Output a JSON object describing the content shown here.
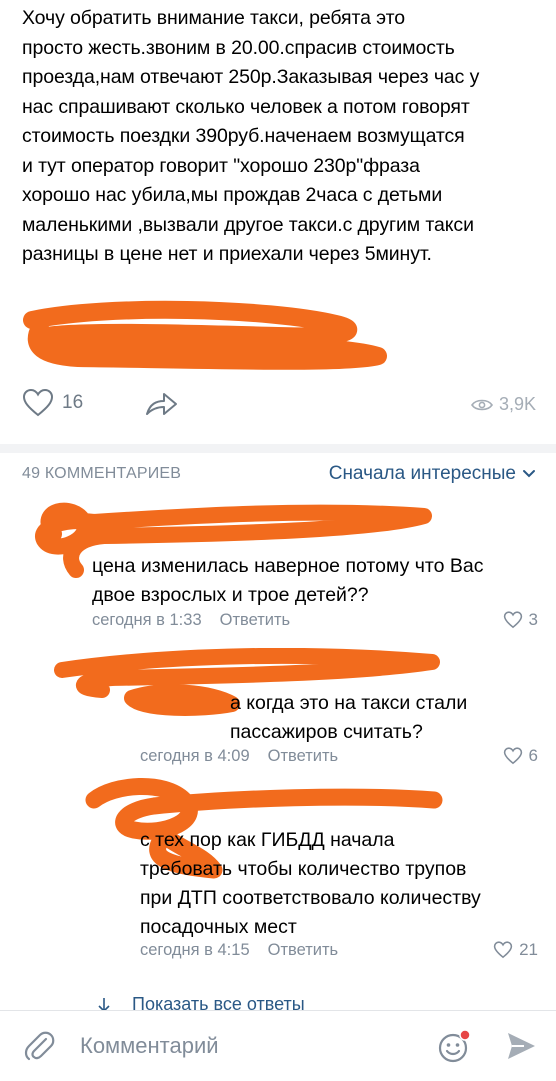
{
  "post": {
    "text": "Хочу обратить внимание такси, ребята это\nпросто жесть.звоним в 20.00.спрасив стоимость\nпроезда,нам отвечают 250р.Заказывая через час у\nнас спрашивают сколько человек а потом говорят\nстоимость поездки 390руб.наченаем возмущатся\nи тут оператор говорит \"хорошо 230р\"фраза\nхорошо нас убила,мы прождав 2часа с детьми\nмаленькими ,вызвали другое такси.с другим такси\nразницы в цене нет и приехали через 5минут.",
    "likes": "16",
    "views": "3,9K"
  },
  "comments_header": {
    "count_label": "49 КОММЕНТАРИЕВ",
    "sort_label": "Сначала интересные"
  },
  "comments": [
    {
      "text": "цена изменилась наверное потому что Вас\nдвое взрослых и трое детей??",
      "time": "сегодня в 1:33",
      "reply_label": "Ответить",
      "likes": "3"
    },
    {
      "text": "а когда это на такси стали\nпассажиров считать?",
      "time": "сегодня в 4:09",
      "reply_label": "Ответить",
      "likes": "6"
    },
    {
      "text": "с тех пор как ГИБДД начала\nтребовать чтобы количество трупов\nпри ДТП соответствовало количеству\nпосадочных мест",
      "time": "сегодня в 4:15",
      "reply_label": "Ответить",
      "likes": "21"
    }
  ],
  "show_all_label": "Показать все ответы",
  "comment_input": {
    "placeholder": "Комментарий"
  },
  "colors": {
    "scribble": "#f26b1d",
    "link": "#2a5885",
    "secondary_text": "#818c99",
    "notification_dot": "#e64646"
  }
}
